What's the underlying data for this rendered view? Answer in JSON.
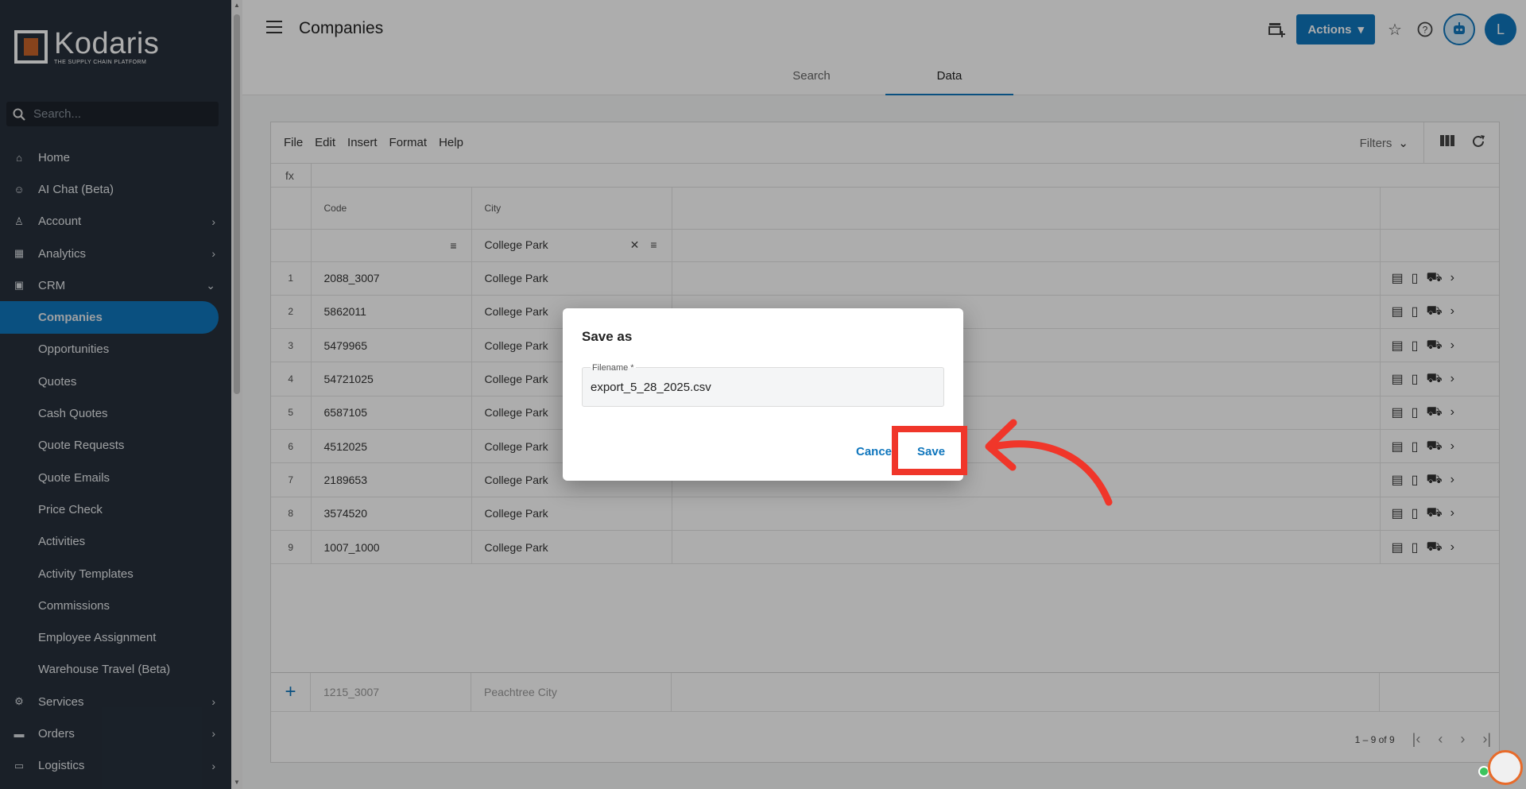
{
  "sidebar": {
    "logo_name": "Kodaris",
    "logo_tagline": "THE SUPPLY CHAIN PLATFORM",
    "search_placeholder": "Search...",
    "items": [
      {
        "label": "Home",
        "icon": "home-icon"
      },
      {
        "label": "AI Chat (Beta)",
        "icon": "robot-icon"
      },
      {
        "label": "Account",
        "icon": "person-icon"
      },
      {
        "label": "Analytics",
        "icon": "chart-icon"
      },
      {
        "label": "CRM",
        "icon": "crm-icon"
      },
      {
        "label": "Companies"
      },
      {
        "label": "Opportunities"
      },
      {
        "label": "Quotes"
      },
      {
        "label": "Cash Quotes"
      },
      {
        "label": "Quote Requests"
      },
      {
        "label": "Quote Emails"
      },
      {
        "label": "Price Check"
      },
      {
        "label": "Activities"
      },
      {
        "label": "Activity Templates"
      },
      {
        "label": "Commissions"
      },
      {
        "label": "Employee Assignment"
      },
      {
        "label": "Warehouse Travel (Beta)"
      },
      {
        "label": "Services",
        "icon": "services-icon"
      },
      {
        "label": "Orders",
        "icon": "truck-icon"
      },
      {
        "label": "Logistics",
        "icon": "logistics-icon"
      }
    ]
  },
  "header": {
    "title": "Companies",
    "actions_label": "Actions",
    "avatar_initial": "L",
    "tabs": [
      {
        "label": "Search"
      },
      {
        "label": "Data"
      }
    ]
  },
  "grid": {
    "menus": [
      "File",
      "Edit",
      "Insert",
      "Format",
      "Help"
    ],
    "filters_label": "Filters",
    "fx_label": "fx",
    "columns": {
      "code": "Code",
      "city": "City"
    },
    "city_filter": "College Park",
    "rows": [
      {
        "num": "1",
        "code": "2088_3007",
        "city": "College Park"
      },
      {
        "num": "2",
        "code": "5862011",
        "city": "College Park"
      },
      {
        "num": "3",
        "code": "5479965",
        "city": "College Park"
      },
      {
        "num": "4",
        "code": "54721025",
        "city": "College Park"
      },
      {
        "num": "5",
        "code": "6587105",
        "city": "College Park"
      },
      {
        "num": "6",
        "code": "4512025",
        "city": "College Park"
      },
      {
        "num": "7",
        "code": "2189653",
        "city": "College Park"
      },
      {
        "num": "8",
        "code": "3574520",
        "city": "College Park"
      },
      {
        "num": "9",
        "code": "1007_1000",
        "city": "College Park"
      }
    ],
    "new_row": {
      "code": "1215_3007",
      "city": "Peachtree City"
    },
    "pagination": "1 – 9 of 9"
  },
  "dialog": {
    "title": "Save as",
    "field_label": "Filename *",
    "filename": "export_5_28_2025.csv",
    "cancel_label": "Cancel",
    "save_label": "Save"
  },
  "colors": {
    "accent": "#0f76bd",
    "annotation": "#f0362a",
    "sidebar": "#27303c"
  }
}
